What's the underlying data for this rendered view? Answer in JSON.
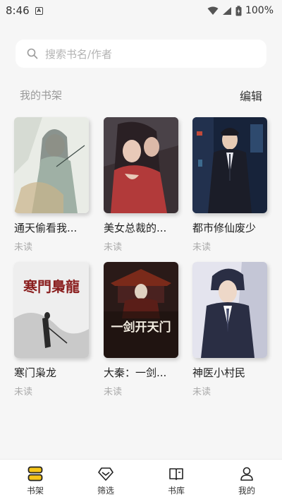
{
  "status_bar": {
    "time": "8:46",
    "notification_letter": "A",
    "battery_percent": "100%"
  },
  "search": {
    "placeholder": "搜索书名/作者"
  },
  "shelf": {
    "title": "我的书架",
    "edit_label": "编辑"
  },
  "books": [
    {
      "title": "通天偷看我...",
      "status": "未读",
      "cover_overlay": "",
      "palette": [
        "#e9ece6",
        "#9fb0a5",
        "#3d4a46"
      ]
    },
    {
      "title": "美女总裁的...",
      "status": "未读",
      "cover_overlay": "",
      "palette": [
        "#3a3034",
        "#b23a3a",
        "#e8c9b8"
      ]
    },
    {
      "title": "都市修仙废少",
      "status": "未读",
      "cover_overlay": "",
      "palette": [
        "#17233a",
        "#2e4a6e",
        "#c24a3a"
      ]
    },
    {
      "title": "寒门枭龙",
      "status": "未读",
      "cover_overlay": "寒門梟龍",
      "palette": [
        "#eeeeee",
        "#c9c9c9",
        "#2a2a2a"
      ]
    },
    {
      "title": "大秦：一剑...",
      "status": "未读",
      "cover_overlay": "一剑开天门",
      "palette": [
        "#2a1a18",
        "#7a2a1a",
        "#e0d2c2"
      ]
    },
    {
      "title": "神医小村民",
      "status": "未读",
      "cover_overlay": "",
      "palette": [
        "#2a2e44",
        "#4a5070",
        "#e4e4ee"
      ]
    }
  ],
  "nav": {
    "items": [
      {
        "label": "书架",
        "icon": "bookshelf-icon",
        "active": true
      },
      {
        "label": "筛选",
        "icon": "diamond-filter-icon",
        "active": false
      },
      {
        "label": "书库",
        "icon": "open-book-icon",
        "active": false
      },
      {
        "label": "我的",
        "icon": "user-icon",
        "active": false
      }
    ],
    "accent": "#f6c619"
  }
}
